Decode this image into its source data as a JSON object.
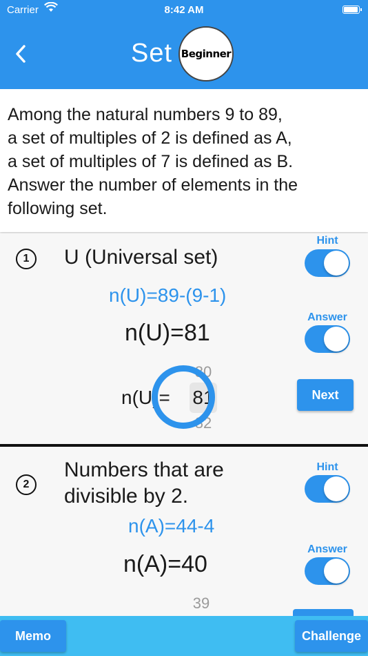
{
  "status": {
    "carrier": "Carrier",
    "time": "8:42 AM"
  },
  "header": {
    "title": "Set",
    "badge": "Beginner"
  },
  "problem": {
    "lines": [
      "Among the natural numbers 9 to 89,",
      "a set of multiples of 2 is defined as A,",
      "a set of multiples of 7 is defined as B.",
      "Answer the number of elements in the",
      "following set."
    ]
  },
  "questions": [
    {
      "number": "1",
      "label": "U (Universal set)",
      "hint_label": "Hint",
      "hint": "n(U)=89-(9-1)",
      "answer_label": "Answer",
      "answer": "n(U)=81",
      "picker_prefix": "n(U)=",
      "picker_above": "80",
      "picker_selected": "81",
      "picker_below": "82",
      "next_label": "Next"
    },
    {
      "number": "2",
      "label_lines": [
        "Numbers that are",
        "divisible by 2."
      ],
      "hint_label": "Hint",
      "hint": "n(A)=44-4",
      "answer_label": "Answer",
      "answer": "n(A)=40",
      "picker_above": "39"
    }
  ],
  "bottom": {
    "memo": "Memo",
    "challenge": "Challenge"
  },
  "colors": {
    "primary": "#2d93ec",
    "bottom_bar": "#3fbdf2"
  }
}
